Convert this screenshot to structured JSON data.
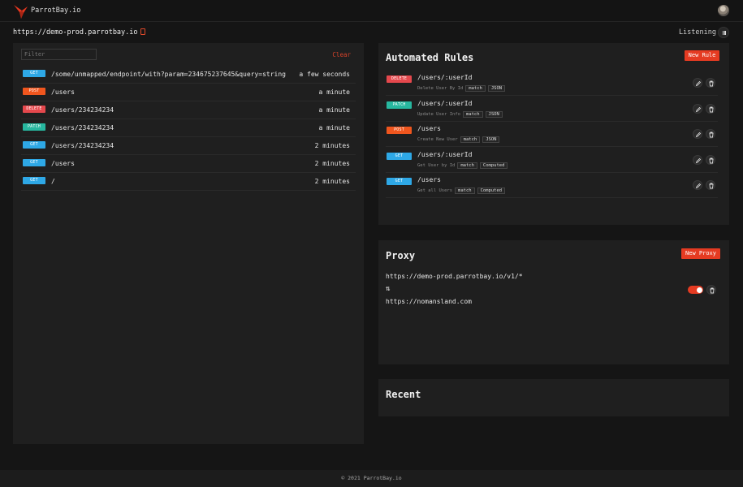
{
  "app": {
    "brand": "ParrotBay.io",
    "accent": "#e53b22"
  },
  "topbar": {
    "url": "https://demo-prod.parrotbay.io",
    "status": "Listening"
  },
  "requests": {
    "filter_placeholder": "Filter",
    "clear_label": "Clear",
    "items": [
      {
        "method": "GET",
        "path": "/some/unmapped/endpoint/with?param=234675237645&query=string",
        "time": "a few seconds"
      },
      {
        "method": "POST",
        "path": "/users",
        "time": "a minute"
      },
      {
        "method": "DELETE",
        "path": "/users/234234234",
        "time": "a minute"
      },
      {
        "method": "PATCH",
        "path": "/users/234234234",
        "time": "a minute"
      },
      {
        "method": "GET",
        "path": "/users/234234234",
        "time": "2 minutes"
      },
      {
        "method": "GET",
        "path": "/users",
        "time": "2 minutes"
      },
      {
        "method": "GET",
        "path": "/",
        "time": "2 minutes"
      }
    ]
  },
  "rules": {
    "title": "Automated Rules",
    "new_label": "New Rule",
    "items": [
      {
        "method": "DELETE",
        "path": "/users/:userId",
        "description": "Delete User By Id",
        "tags": [
          "match",
          "JSON"
        ]
      },
      {
        "method": "PATCH",
        "path": "/users/:userId",
        "description": "Update User Info",
        "tags": [
          "match",
          "JSON"
        ]
      },
      {
        "method": "POST",
        "path": "/users",
        "description": "Create New User",
        "tags": [
          "match",
          "JSON"
        ]
      },
      {
        "method": "GET",
        "path": "/users/:userId",
        "description": "Get User by Id",
        "tags": [
          "match",
          "Computed"
        ]
      },
      {
        "method": "GET",
        "path": "/users",
        "description": "Get all Users",
        "tags": [
          "match",
          "Computed"
        ]
      }
    ]
  },
  "proxy": {
    "title": "Proxy",
    "new_label": "New Proxy",
    "source": "https://demo-prod.parrotbay.io/v1/*",
    "arrow": "⇅",
    "target": "https://nomansland.com",
    "enabled": true
  },
  "recent": {
    "title": "Recent"
  },
  "footer": {
    "text": "© 2021 ParrotBay.io"
  }
}
